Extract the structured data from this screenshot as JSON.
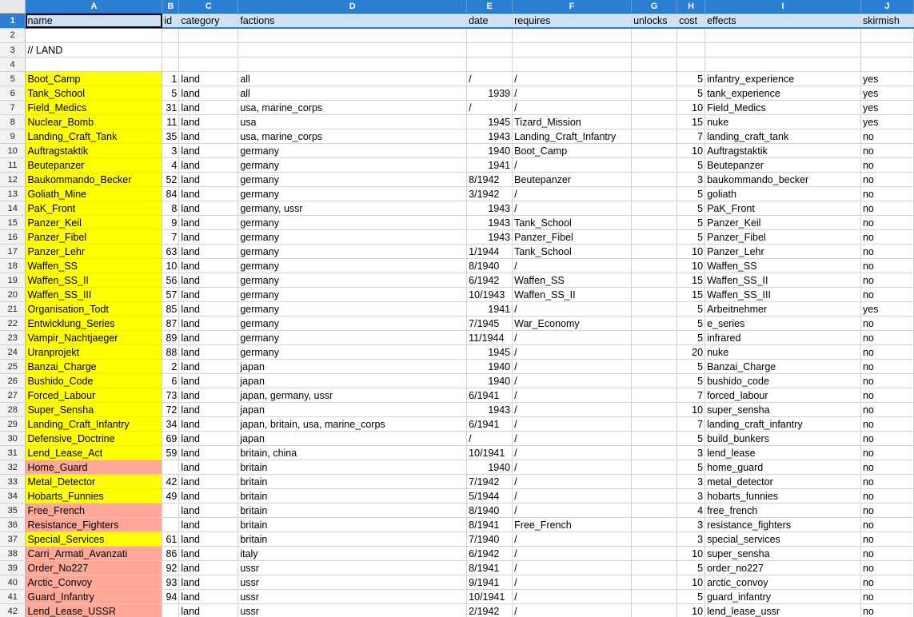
{
  "columns": [
    "A",
    "B",
    "C",
    "D",
    "E",
    "F",
    "G",
    "H",
    "I",
    "J"
  ],
  "active_row": 1,
  "selected_cell": "A1",
  "header_row": [
    "name",
    "id",
    "category",
    "factions",
    "date",
    "requires",
    "unlocks",
    "cost",
    "effects",
    "skirmish"
  ],
  "section_label": "// LAND",
  "colors": {
    "header_blue": "#2a7fd5",
    "highlight_yellow": "#ffff00",
    "highlight_salmon": "#ffa898",
    "header_row_fill": "#cfe2f5"
  },
  "rows": [
    {
      "n": 5,
      "hl": "y",
      "c": [
        "Boot_Camp",
        "1",
        "land",
        "all",
        "/",
        "/",
        "",
        "5",
        "infantry_experience",
        "yes"
      ]
    },
    {
      "n": 6,
      "hl": "y",
      "c": [
        "Tank_School",
        "5",
        "land",
        "all",
        "1939",
        "/",
        "",
        "5",
        "tank_experience",
        "yes"
      ]
    },
    {
      "n": 7,
      "hl": "y",
      "c": [
        "Field_Medics",
        "31",
        "land",
        "usa, marine_corps",
        "/",
        "/",
        "",
        "10",
        "Field_Medics",
        "yes"
      ]
    },
    {
      "n": 8,
      "hl": "y",
      "c": [
        "Nuclear_Bomb",
        "11",
        "land",
        "usa",
        "1945",
        "Tizard_Mission",
        "",
        "15",
        "nuke",
        "yes"
      ]
    },
    {
      "n": 9,
      "hl": "y",
      "c": [
        "Landing_Craft_Tank",
        "35",
        "land",
        "usa, marine_corps",
        "1943",
        "Landing_Craft_Infantry",
        "",
        "7",
        "landing_craft_tank",
        "no"
      ]
    },
    {
      "n": 10,
      "hl": "y",
      "c": [
        "Auftragstaktik",
        "3",
        "land",
        "germany",
        "1940",
        "Boot_Camp",
        "",
        "10",
        "Auftragstaktik",
        "no"
      ]
    },
    {
      "n": 11,
      "hl": "y",
      "c": [
        "Beutepanzer",
        "4",
        "land",
        "germany",
        "1941",
        "/",
        "",
        "5",
        "Beutepanzer",
        "no"
      ]
    },
    {
      "n": 12,
      "hl": "y",
      "c": [
        "Baukommando_Becker",
        "52",
        "land",
        "germany",
        "8/1942",
        "Beutepanzer",
        "",
        "3",
        "baukommando_becker",
        "no"
      ]
    },
    {
      "n": 13,
      "hl": "y",
      "c": [
        "Goliath_Mine",
        "84",
        "land",
        "germany",
        "3/1942",
        "/",
        "",
        "5",
        "goliath",
        "no"
      ]
    },
    {
      "n": 14,
      "hl": "y",
      "c": [
        "PaK_Front",
        "8",
        "land",
        "germany, ussr",
        "1943",
        "/",
        "",
        "5",
        "PaK_Front",
        "no"
      ]
    },
    {
      "n": 15,
      "hl": "y",
      "c": [
        "Panzer_Keil",
        "9",
        "land",
        "germany",
        "1943",
        "Tank_School",
        "",
        "5",
        "Panzer_Keil",
        "no"
      ]
    },
    {
      "n": 16,
      "hl": "y",
      "c": [
        "Panzer_Fibel",
        "7",
        "land",
        "germany",
        "1943",
        "Panzer_Fibel",
        "",
        "5",
        "Panzer_Fibel",
        "no"
      ]
    },
    {
      "n": 17,
      "hl": "y",
      "c": [
        "Panzer_Lehr",
        "63",
        "land",
        "germany",
        "1/1944",
        "Tank_School",
        "",
        "10",
        "Panzer_Lehr",
        "no"
      ]
    },
    {
      "n": 18,
      "hl": "y",
      "c": [
        "Waffen_SS",
        "10",
        "land",
        "germany",
        "8/1940",
        "/",
        "",
        "10",
        "Waffen_SS",
        "no"
      ]
    },
    {
      "n": 19,
      "hl": "y",
      "c": [
        "Waffen_SS_II",
        "56",
        "land",
        "germany",
        "6/1942",
        "Waffen_SS",
        "",
        "15",
        "Waffen_SS_II",
        "no"
      ]
    },
    {
      "n": 20,
      "hl": "y",
      "c": [
        "Waffen_SS_III",
        "57",
        "land",
        "germany",
        "10/1943",
        "Waffen_SS_II",
        "",
        "15",
        "Waffen_SS_III",
        "no"
      ]
    },
    {
      "n": 21,
      "hl": "y",
      "c": [
        "Organisation_Todt",
        "85",
        "land",
        "germany",
        "1941",
        "/",
        "",
        "5",
        "Arbeitnehmer",
        "yes"
      ]
    },
    {
      "n": 22,
      "hl": "y",
      "c": [
        "Entwicklung_Series",
        "87",
        "land",
        "germany",
        "7/1945",
        "War_Economy",
        "",
        "5",
        "e_series",
        "no"
      ]
    },
    {
      "n": 23,
      "hl": "y",
      "c": [
        "Vampir_Nachtjaeger",
        "89",
        "land",
        "germany",
        "11/1944",
        "/",
        "",
        "5",
        "infrared",
        "no"
      ]
    },
    {
      "n": 24,
      "hl": "y",
      "c": [
        "Uranprojekt",
        "88",
        "land",
        "germany",
        "1945",
        "/",
        "",
        "20",
        "nuke",
        "no"
      ]
    },
    {
      "n": 25,
      "hl": "y",
      "c": [
        "Banzai_Charge",
        "2",
        "land",
        "japan",
        "1940",
        "/",
        "",
        "5",
        "Banzai_Charge",
        "no"
      ]
    },
    {
      "n": 26,
      "hl": "y",
      "c": [
        "Bushido_Code",
        "6",
        "land",
        "japan",
        "1940",
        "/",
        "",
        "5",
        "bushido_code",
        "no"
      ]
    },
    {
      "n": 27,
      "hl": "y",
      "c": [
        "Forced_Labour",
        "73",
        "land",
        "japan, germany, ussr",
        "6/1941",
        "/",
        "",
        "7",
        "forced_labour",
        "no"
      ]
    },
    {
      "n": 28,
      "hl": "y",
      "c": [
        "Super_Sensha",
        "72",
        "land",
        "japan",
        "1943",
        "/",
        "",
        "10",
        "super_sensha",
        "no"
      ]
    },
    {
      "n": 29,
      "hl": "y",
      "c": [
        "Landing_Craft_Infantry",
        "34",
        "land",
        "japan, britain, usa, marine_corps",
        "6/1941",
        "/",
        "",
        "7",
        "landing_craft_infantry",
        "no"
      ]
    },
    {
      "n": 30,
      "hl": "y",
      "c": [
        "Defensive_Doctrine",
        "69",
        "land",
        "japan",
        "/",
        "/",
        "",
        "5",
        "build_bunkers",
        "no"
      ]
    },
    {
      "n": 31,
      "hl": "y",
      "c": [
        "Lend_Lease_Act",
        "59",
        "land",
        "britain, china",
        "10/1941",
        "/",
        "",
        "3",
        "lend_lease",
        "no"
      ]
    },
    {
      "n": 32,
      "hl": "r",
      "c": [
        "Home_Guard",
        "",
        "land",
        "britain",
        "1940",
        "/",
        "",
        "5",
        "home_guard",
        "no"
      ]
    },
    {
      "n": 33,
      "hl": "y",
      "c": [
        "Metal_Detector",
        "42",
        "land",
        "britain",
        "7/1942",
        "/",
        "",
        "3",
        "metal_detector",
        "no"
      ]
    },
    {
      "n": 34,
      "hl": "y",
      "c": [
        "Hobarts_Funnies",
        "49",
        "land",
        "britain",
        "5/1944",
        "/",
        "",
        "3",
        "hobarts_funnies",
        "no"
      ]
    },
    {
      "n": 35,
      "hl": "r",
      "c": [
        "Free_French",
        "",
        "land",
        "britain",
        "8/1940",
        "/",
        "",
        "4",
        "free_french",
        "no"
      ]
    },
    {
      "n": 36,
      "hl": "r",
      "c": [
        "Resistance_Fighters",
        "",
        "land",
        "britain",
        "8/1941",
        "Free_French",
        "",
        "3",
        "resistance_fighters",
        "no"
      ]
    },
    {
      "n": 37,
      "hl": "y",
      "c": [
        "Special_Services",
        "61",
        "land",
        "britain",
        "7/1940",
        "/",
        "",
        "3",
        "special_services",
        "no"
      ]
    },
    {
      "n": 38,
      "hl": "r",
      "c": [
        "Carri_Armati_Avanzati",
        "86",
        "land",
        "italy",
        "6/1942",
        "/",
        "",
        "10",
        "super_sensha",
        "no"
      ]
    },
    {
      "n": 39,
      "hl": "r",
      "c": [
        "Order_No227",
        "92",
        "land",
        "ussr",
        "8/1941",
        "/",
        "",
        "5",
        "order_no227",
        "no"
      ]
    },
    {
      "n": 40,
      "hl": "r",
      "c": [
        "Arctic_Convoy",
        "93",
        "land",
        "ussr",
        "9/1941",
        "/",
        "",
        "10",
        "arctic_convoy",
        "no"
      ]
    },
    {
      "n": 41,
      "hl": "r",
      "c": [
        "Guard_Infantry",
        "94",
        "land",
        "ussr",
        "10/1941",
        "/",
        "",
        "5",
        "guard_infantry",
        "no"
      ]
    },
    {
      "n": 42,
      "hl": "r",
      "c": [
        "Lend_Lease_USSR",
        "",
        "land",
        "ussr",
        "2/1942",
        "/",
        "",
        "10",
        "lend_lease_ussr",
        "no"
      ]
    }
  ],
  "empty_rows_after": [
    43,
    44
  ]
}
